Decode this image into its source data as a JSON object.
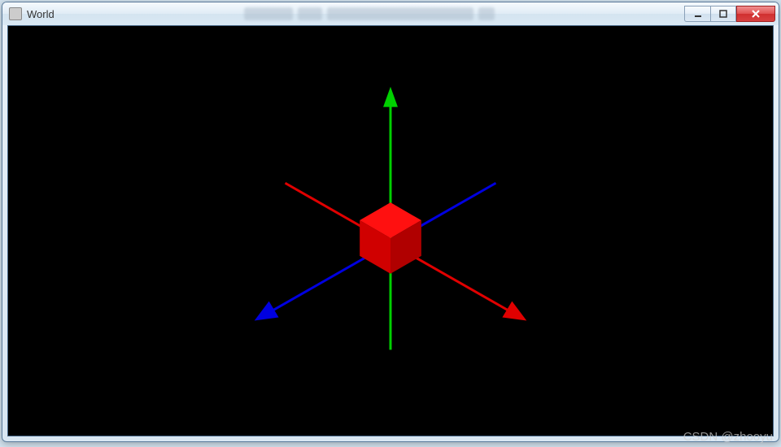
{
  "window": {
    "title": "World"
  },
  "controls": {
    "minimize": "minimize",
    "maximize": "maximize",
    "close": "close"
  },
  "scene": {
    "background": "#000000",
    "cube_color": "#ff0000",
    "axes": [
      {
        "name": "y",
        "color": "#00d000",
        "dir": "up"
      },
      {
        "name": "x",
        "color": "#e00000",
        "dir": "right-down"
      },
      {
        "name": "z",
        "color": "#0000e0",
        "dir": "left-down"
      }
    ]
  },
  "watermark": "CSDN @zhooyu"
}
